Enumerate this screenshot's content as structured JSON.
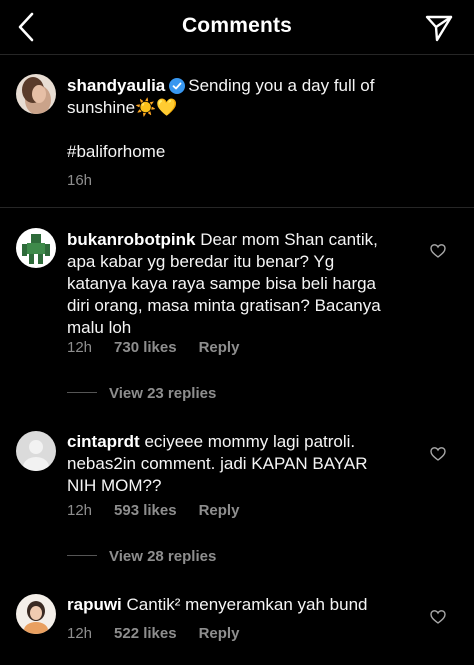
{
  "header": {
    "title": "Comments"
  },
  "caption": {
    "username": "shandyaulia",
    "text_line1": "Sending you a day full of",
    "text_line2": "sunshine",
    "emojis": "☀️💛",
    "hashtag": "#baliforhome",
    "time": "16h"
  },
  "comments": [
    {
      "username": "bukanrobotpink",
      "lines": [
        "Dear mom Shan cantik,",
        "apa kabar yg beredar itu benar? Yg",
        "katanya kaya raya sampe bisa beli harga",
        "diri orang, masa minta gratisan? Bacanya",
        "malu loh"
      ],
      "time": "12h",
      "likes": "730 likes",
      "reply": "Reply",
      "view_replies": "View 23 replies"
    },
    {
      "username": "cintaprdt",
      "lines": [
        "eciyeee mommy lagi patroli.",
        "nebas2in comment. jadi KAPAN BAYAR",
        "NIH MOM??"
      ],
      "time": "12h",
      "likes": "593 likes",
      "reply": "Reply",
      "view_replies": "View 28 replies"
    },
    {
      "username": "rapuwi",
      "lines": [
        "Cantik² menyeramkan yah bund"
      ],
      "time": "12h",
      "likes": "522 likes",
      "reply": "Reply"
    }
  ],
  "colors": {
    "background": "#000000",
    "secondary_text": "#8e8e8e",
    "verified_blue": "#3897f0",
    "divider": "#262626"
  }
}
